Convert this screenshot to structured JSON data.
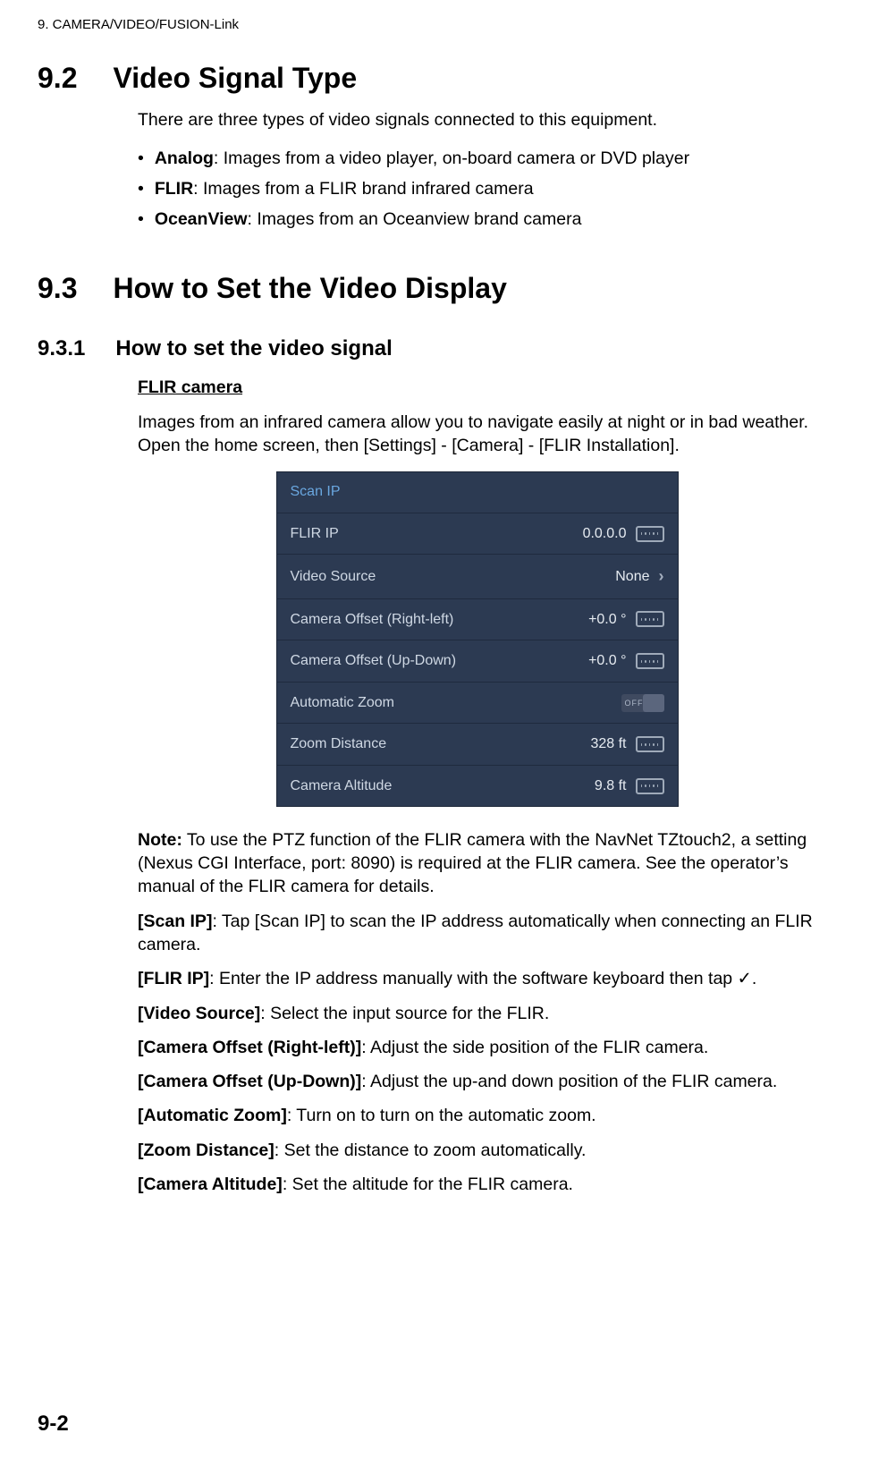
{
  "running_head": "9.  CAMERA/VIDEO/FUSION-Link",
  "sec92": {
    "num": "9.2",
    "title": "Video Signal Type",
    "intro": "There are three types of video signals connected to this equipment.",
    "bullets": [
      {
        "term": "Analog",
        "rest": ": Images from a video player, on-board camera or DVD player"
      },
      {
        "term": "FLIR",
        "rest": ": Images from a FLIR brand infrared camera"
      },
      {
        "term": "OceanView",
        "rest": ": Images from an Oceanview brand camera"
      }
    ]
  },
  "sec93": {
    "num": "9.3",
    "title": "How to Set the Video Display"
  },
  "sec931": {
    "num": "9.3.1",
    "title": "How to set the video signal",
    "flir_heading": "FLIR camera",
    "flir_para": "Images from an infrared camera allow you to navigate easily at night or in bad weather. Open the home screen, then [Settings] - [Camera] - [FLIR Installation]."
  },
  "panel": {
    "scan_ip": "Scan IP",
    "flir_ip_label": "FLIR IP",
    "flir_ip_value": "0.0.0.0",
    "video_source_label": "Video Source",
    "video_source_value": "None",
    "offset_rl_label": "Camera Offset (Right-left)",
    "offset_rl_value": "+0.0 °",
    "offset_ud_label": "Camera Offset (Up-Down)",
    "offset_ud_value": "+0.0 °",
    "auto_zoom_label": "Automatic Zoom",
    "auto_zoom_state": "OFF",
    "zoom_dist_label": "Zoom Distance",
    "zoom_dist_value": "328 ft",
    "cam_alt_label": "Camera Altitude",
    "cam_alt_value": "9.8 ft"
  },
  "note": {
    "label": "Note:",
    "text": " To use the PTZ function of the FLIR camera with the NavNet TZtouch2, a setting (Nexus CGI Interface, port: 8090) is required at the FLIR camera. See the operator’s manual of the FLIR camera for details."
  },
  "defs": {
    "scan_ip": {
      "term": "[Scan IP]",
      "desc": ": Tap [Scan IP] to scan the IP address automatically when connecting an FLIR camera."
    },
    "flir_ip": {
      "term": "[FLIR IP]",
      "desc": ": Enter the IP address manually with the software keyboard then tap ✓."
    },
    "video_source": {
      "term": "[Video Source]",
      "desc": ": Select the input source for the FLIR."
    },
    "offset_rl": {
      "term": "[Camera Offset (Right-left)]",
      "desc": ": Adjust the side position of the FLIR camera."
    },
    "offset_ud": {
      "term": "[Camera Offset (Up-Down)]",
      "desc": ": Adjust the up-and down position of the FLIR camera."
    },
    "auto_zoom": {
      "term": "[Automatic Zoom]",
      "desc": ": Turn on to turn on the automatic zoom."
    },
    "zoom_dist": {
      "term": "[Zoom Distance]",
      "desc": ": Set the distance to zoom automatically."
    },
    "cam_alt": {
      "term": "[Camera Altitude]",
      "desc": ": Set the altitude for the FLIR camera."
    }
  },
  "page_number": "9-2"
}
